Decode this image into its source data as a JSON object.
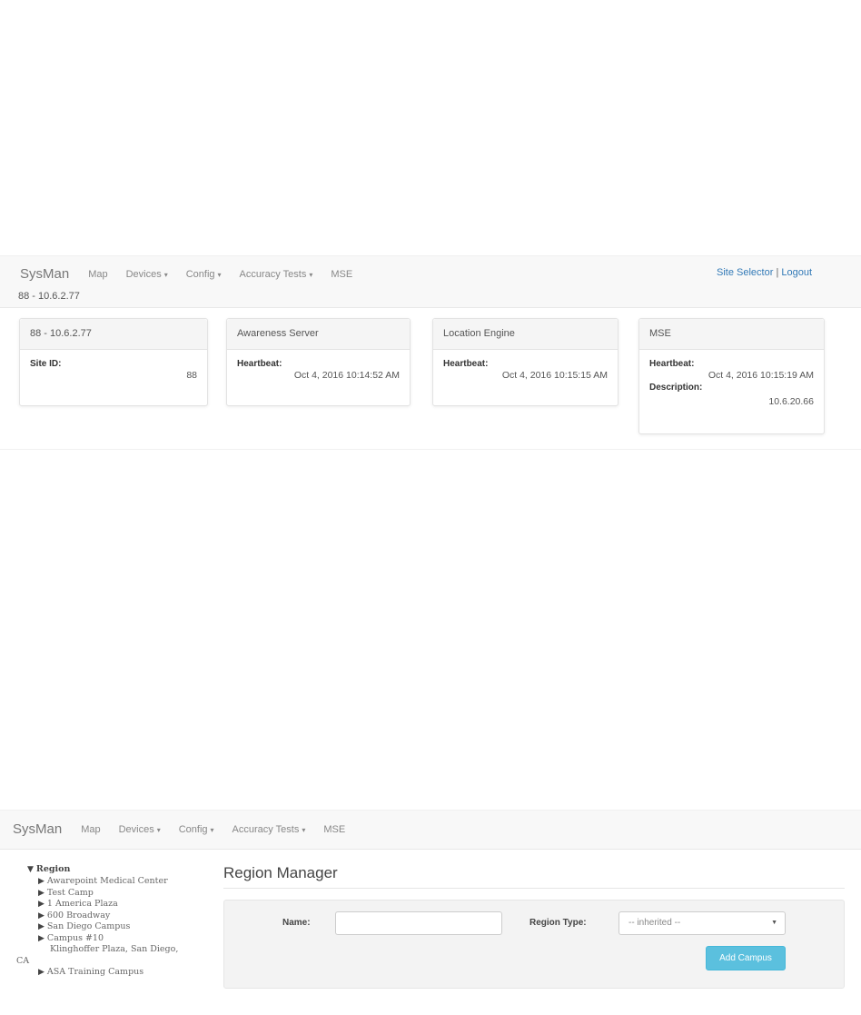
{
  "top": {
    "brand": "SysMan",
    "nav": [
      {
        "label": "Map",
        "dropdown": false
      },
      {
        "label": "Devices",
        "dropdown": true
      },
      {
        "label": "Config",
        "dropdown": true
      },
      {
        "label": "Accuracy Tests",
        "dropdown": true
      },
      {
        "label": "MSE",
        "dropdown": false
      }
    ],
    "site_selector": "Site Selector",
    "separator": "|",
    "logout": "Logout",
    "site_label": "88 - 10.6.2.77",
    "cards": [
      {
        "title": "88 - 10.6.2.77",
        "rows": [
          {
            "label": "Site ID:",
            "value": "88"
          }
        ]
      },
      {
        "title": "Awareness Server",
        "rows": [
          {
            "label": "Heartbeat:",
            "value": "Oct 4, 2016 10:14:52 AM"
          }
        ]
      },
      {
        "title": "Location Engine",
        "rows": [
          {
            "label": "Heartbeat:",
            "value": "Oct 4, 2016 10:15:15 AM"
          }
        ]
      },
      {
        "title": "MSE",
        "rows": [
          {
            "label": "Heartbeat:",
            "value": "Oct 4, 2016 10:15:19 AM"
          },
          {
            "label": "Description:",
            "value": "10.6.20.66"
          }
        ]
      }
    ]
  },
  "bottom": {
    "brand": "SysMan",
    "nav": [
      {
        "label": "Map",
        "dropdown": false
      },
      {
        "label": "Devices",
        "dropdown": true
      },
      {
        "label": "Config",
        "dropdown": true
      },
      {
        "label": "Accuracy Tests",
        "dropdown": true
      },
      {
        "label": "MSE",
        "dropdown": false
      }
    ],
    "tree": {
      "root": "Region",
      "items": [
        "Awarepoint Medical Center",
        "Test Camp",
        "1 America Plaza",
        "600 Broadway",
        "San Diego Campus",
        "Campus #10",
        "ASA Training Campus"
      ],
      "campus10_detail_line1": "Klinghoffer Plaza, San Diego,",
      "campus10_detail_line2": "CA"
    },
    "region_manager": {
      "title": "Region Manager",
      "name_label": "Name:",
      "name_value": "",
      "region_type_label": "Region Type:",
      "region_type_selected": "-- inherited --",
      "add_button": "Add Campus"
    }
  }
}
